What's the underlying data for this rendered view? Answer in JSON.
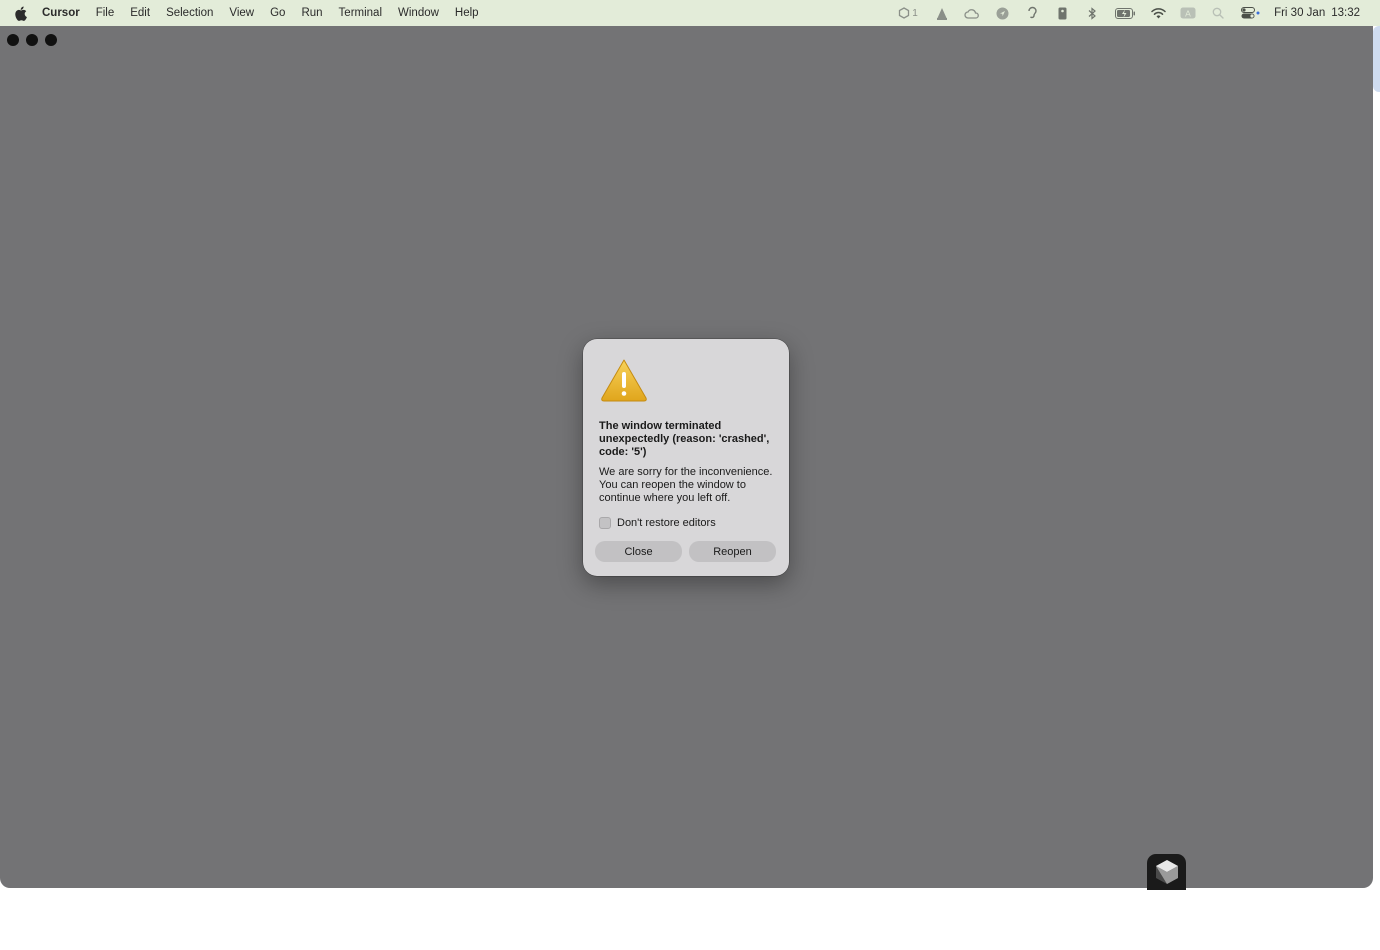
{
  "menubar": {
    "apple_icon": "apple-icon",
    "app_name": "Cursor",
    "items": [
      "File",
      "Edit",
      "Selection",
      "View",
      "Go",
      "Run",
      "Terminal",
      "Window",
      "Help"
    ],
    "status": {
      "notification_count": "1",
      "icons": [
        "cube-status-icon",
        "vlc-icon",
        "cloud-icon",
        "navigation-icon",
        "hearing-icon",
        "battery-small-icon",
        "bluetooth-icon",
        "battery-charging-icon",
        "wifi-icon",
        "keyboard-input-icon",
        "search-icon",
        "control-center-icon"
      ],
      "date": "Fri 30 Jan",
      "time": "13:32"
    }
  },
  "window": {
    "background_color": "#737375"
  },
  "dialog": {
    "icon": "warning-icon",
    "title": "The window terminated unexpectedly (reason: 'crashed', code: '5')",
    "message": "We are sorry for the inconvenience. You can reopen the window to continue where you left off.",
    "checkbox_label": "Don't restore editors",
    "checkbox_checked": false,
    "close_label": "Close",
    "reopen_label": "Reopen"
  },
  "dock": {
    "icon": "cursor-app-icon"
  }
}
